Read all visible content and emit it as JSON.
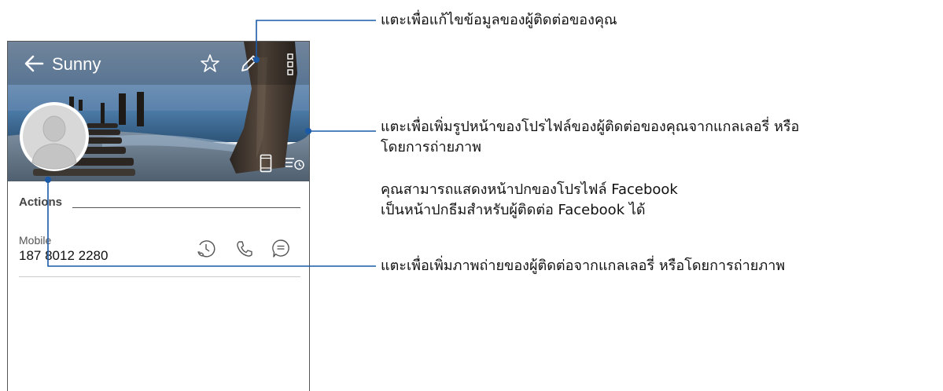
{
  "contact": {
    "name": "Sunny",
    "section_title": "Actions",
    "phone_type": "Mobile",
    "phone_number": "187 8012 2280"
  },
  "icons": {
    "back": "arrow-left-icon",
    "favorite": "star-outline-icon",
    "edit": "pencil-icon",
    "more": "more-vertical-icon",
    "avatar": "avatar-placeholder-icon",
    "phone_device": "phone-device-icon",
    "history": "call-history-icon",
    "call_log": "call-log-icon",
    "call": "phone-icon",
    "message": "message-icon"
  },
  "callouts": {
    "edit": "แตะเพื่อแก้ไขข้อมูลของผู้ติดต่อของคุณ",
    "photo_line1": "แตะเพื่อเพิ่มรูปหน้าของโปรไฟล์ของผู้ติดต่อของคุณจากแกลเลอรี่ หรือ",
    "photo_line2": "โดยการถ่ายภาพ",
    "facebook_line1": "คุณสามารถแสดงหน้าปกของโปรไฟล์ Facebook",
    "facebook_line2": "เป็นหน้าปกธีมสำหรับผู้ติดต่อ Facebook ได้",
    "avatar": "แตะเพื่อเพิ่มภาพถ่ายของผู้ติดต่อจากแกลเลอรี่ หรือโดยการถ่ายภาพ"
  },
  "colors": {
    "callout_line": "#1a5aa6",
    "sky": "#5a7fa8",
    "sea": "#3f6e96"
  }
}
